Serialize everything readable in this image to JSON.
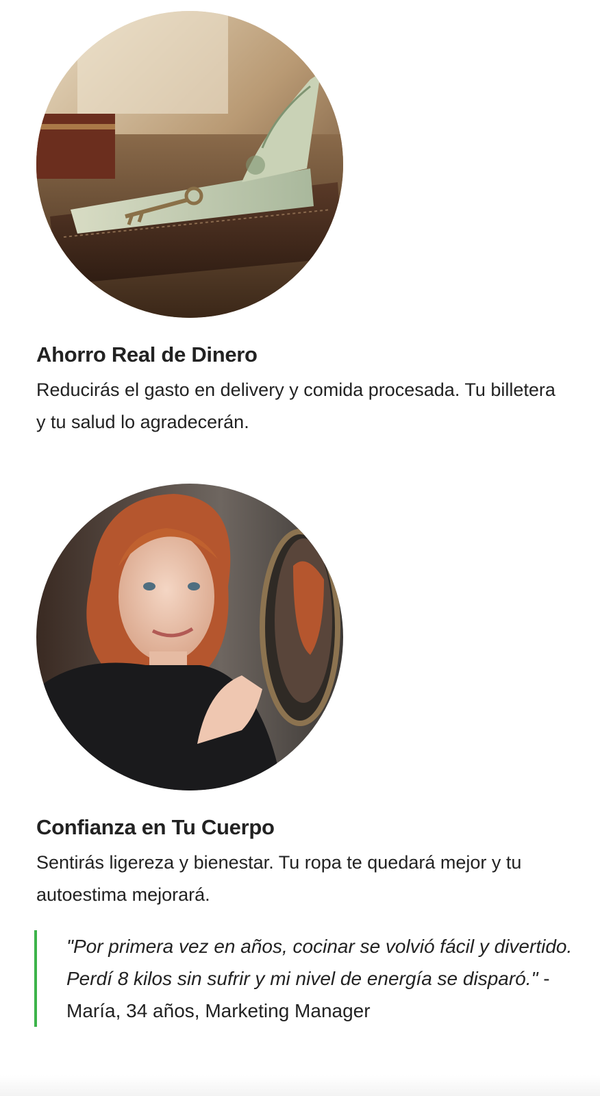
{
  "features": [
    {
      "image_icon": "money-wallet-key-photo",
      "title": "Ahorro Real de Dinero",
      "description": "Reducirás el gasto en delivery y comida procesada. Tu billetera y tu salud lo agradecerán."
    },
    {
      "image_icon": "woman-mirror-photo",
      "title": "Confianza en Tu Cuerpo",
      "description": "Sentirás ligereza y bienestar. Tu ropa te quedará mejor y tu autoestima mejorará."
    }
  ],
  "testimonial": {
    "quote": "\"Por primera vez en años, cocinar se volvió fácil y divertido. Perdí 8 kilos sin sufrir y mi nivel de energía se disparó.\"",
    "attribution": " - María, 34 años, Marketing Manager"
  },
  "colors": {
    "accent_border": "#3cb34a",
    "text": "#222222",
    "background": "#ffffff"
  }
}
